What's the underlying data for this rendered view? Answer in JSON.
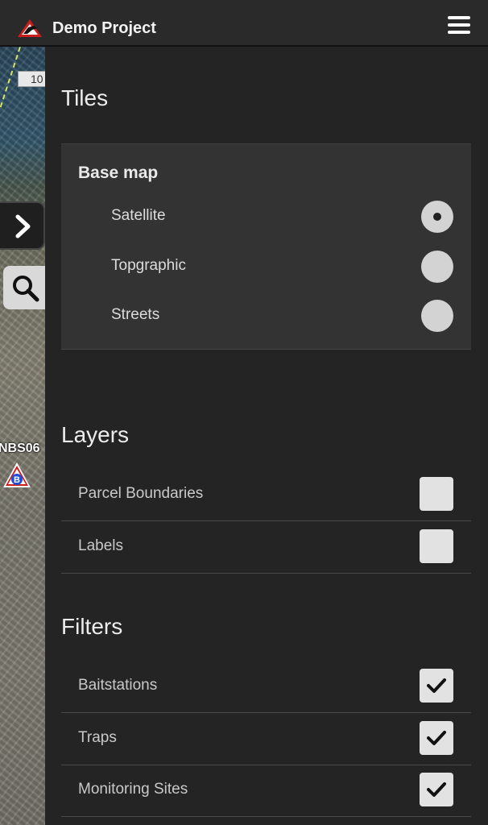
{
  "header": {
    "title": "Demo Project",
    "logo_icon": "bird-logo-icon",
    "menu_icon": "hamburger-menu-icon"
  },
  "map": {
    "road_sign": "10",
    "site_label": "NBS06",
    "site_marker_letter": "B",
    "collapse_icon": "chevron-right-icon",
    "search_icon": "search-icon"
  },
  "tiles": {
    "title": "Tiles",
    "card_title": "Base map",
    "options": [
      {
        "label": "Satellite",
        "selected": true
      },
      {
        "label": "Topgraphic",
        "selected": false
      },
      {
        "label": "Streets",
        "selected": false
      }
    ]
  },
  "layers": {
    "title": "Layers",
    "items": [
      {
        "label": "Parcel Boundaries",
        "checked": false
      },
      {
        "label": "Labels",
        "checked": false
      }
    ]
  },
  "filters": {
    "title": "Filters",
    "items": [
      {
        "label": "Baitstations",
        "checked": true
      },
      {
        "label": "Traps",
        "checked": true
      },
      {
        "label": "Monitoring Sites",
        "checked": true
      }
    ]
  },
  "colors": {
    "panel_bg": "#242424",
    "card_bg": "#333333",
    "control": "#d3d3d3",
    "marker_blue": "#1e4fd6",
    "marker_red": "#d01c1c"
  }
}
